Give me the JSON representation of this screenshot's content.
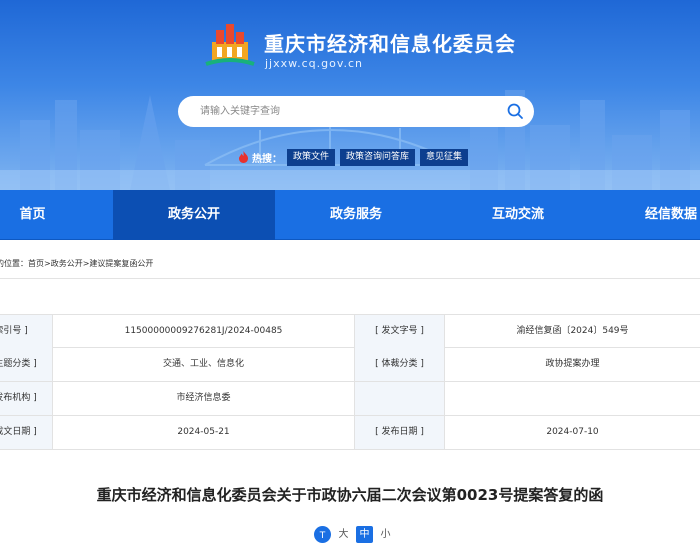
{
  "header": {
    "site_title": "重庆市经济和信息化委员会",
    "site_url": "jjxxw.cq.gov.cn",
    "logo_icon": "city-emblem-icon"
  },
  "search": {
    "placeholder": "请输入关键字查询",
    "value": "",
    "icon": "search-icon"
  },
  "hot_search": {
    "label": "热搜：",
    "icon": "fire-icon",
    "tags": [
      "政策文件",
      "政策咨询问答库",
      "意见征集"
    ]
  },
  "nav": {
    "items": [
      "首页",
      "政务公开",
      "政务服务",
      "互动交流",
      "经信数据"
    ],
    "active": "政务公开"
  },
  "breadcrumb": {
    "prefix": "您的位置：",
    "items": [
      "首页",
      "政务公开",
      "建议提案复函公开"
    ],
    "separator": ">"
  },
  "metadata": {
    "rows": [
      {
        "label1": "[ 索引号 ]",
        "value1": "11500000009276281J/2024-00485",
        "label2": "[ 发文字号 ]",
        "value2": "渝经信复函〔2024〕549号"
      },
      {
        "label1": "[ 主题分类 ]",
        "value1": "交通、工业、信息化",
        "label2": "[ 体裁分类 ]",
        "value2": "政协提案办理"
      },
      {
        "label1": "[ 发布机构 ]",
        "value1": "市经济信息委",
        "label2": "",
        "value2": ""
      },
      {
        "label1": "[ 成文日期 ]",
        "value1": "2024-05-21",
        "label2": "[ 发布日期 ]",
        "value2": "2024-07-10"
      }
    ]
  },
  "article": {
    "title": "重庆市经济和信息化委员会关于市政协六届二次会议第0023号提案答复的函",
    "font_size": {
      "icon": "font-size-icon",
      "options": [
        "大",
        "中",
        "小"
      ],
      "selected": "中"
    }
  },
  "colors": {
    "brand_blue": "#1a6fe3",
    "nav_active": "#0c4fb3",
    "hot_tag_bg": "#0d3f8f",
    "label_bg": "#f2f6fb"
  }
}
